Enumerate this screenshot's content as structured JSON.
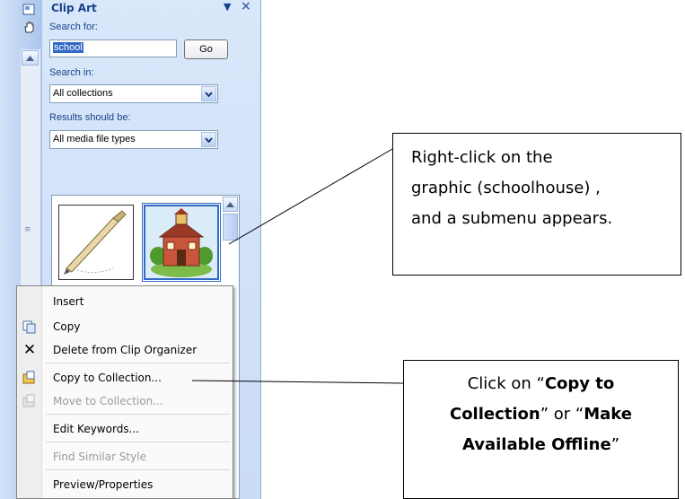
{
  "pane": {
    "title": "Clip Art",
    "search_for_label": "Search for:",
    "search_value": "school",
    "go_label": "Go",
    "search_in_label": "Search in:",
    "search_in_value": "All collections",
    "results_label": "Results should be:",
    "results_value": "All media file types"
  },
  "menu": {
    "items": [
      {
        "label": "Insert",
        "icon": "none",
        "enabled": true
      },
      {
        "label": "Copy",
        "icon": "copy-icon",
        "enabled": true
      },
      {
        "label": "Delete from Clip Organizer",
        "icon": "delete-x-icon",
        "enabled": true
      },
      {
        "label": "Copy to Collection...",
        "icon": "copy-to-collection-icon",
        "enabled": true
      },
      {
        "label": "Move to Collection...",
        "icon": "move-to-collection-icon",
        "enabled": false
      },
      {
        "label": "Edit Keywords...",
        "icon": "none",
        "enabled": true
      },
      {
        "label": "Find Similar Style",
        "icon": "none",
        "enabled": false
      },
      {
        "label": "Preview/Properties",
        "icon": "none",
        "enabled": true
      }
    ]
  },
  "callout1": {
    "line1": "Right-click on the",
    "line2": "graphic (schoolhouse) ,",
    "line3": "and a submenu appears."
  },
  "callout2": {
    "line1_a": "Click on “",
    "line1_b": "Copy to",
    "line2_a": "Collection",
    "line2_b": "” or “",
    "line2_c": "Make",
    "line3_a": "Available Offline",
    "line3_b": "”"
  },
  "colors": {
    "pane_bg": "#cbdcf5",
    "title_text": "#15428b",
    "selection": "#316ac5"
  }
}
